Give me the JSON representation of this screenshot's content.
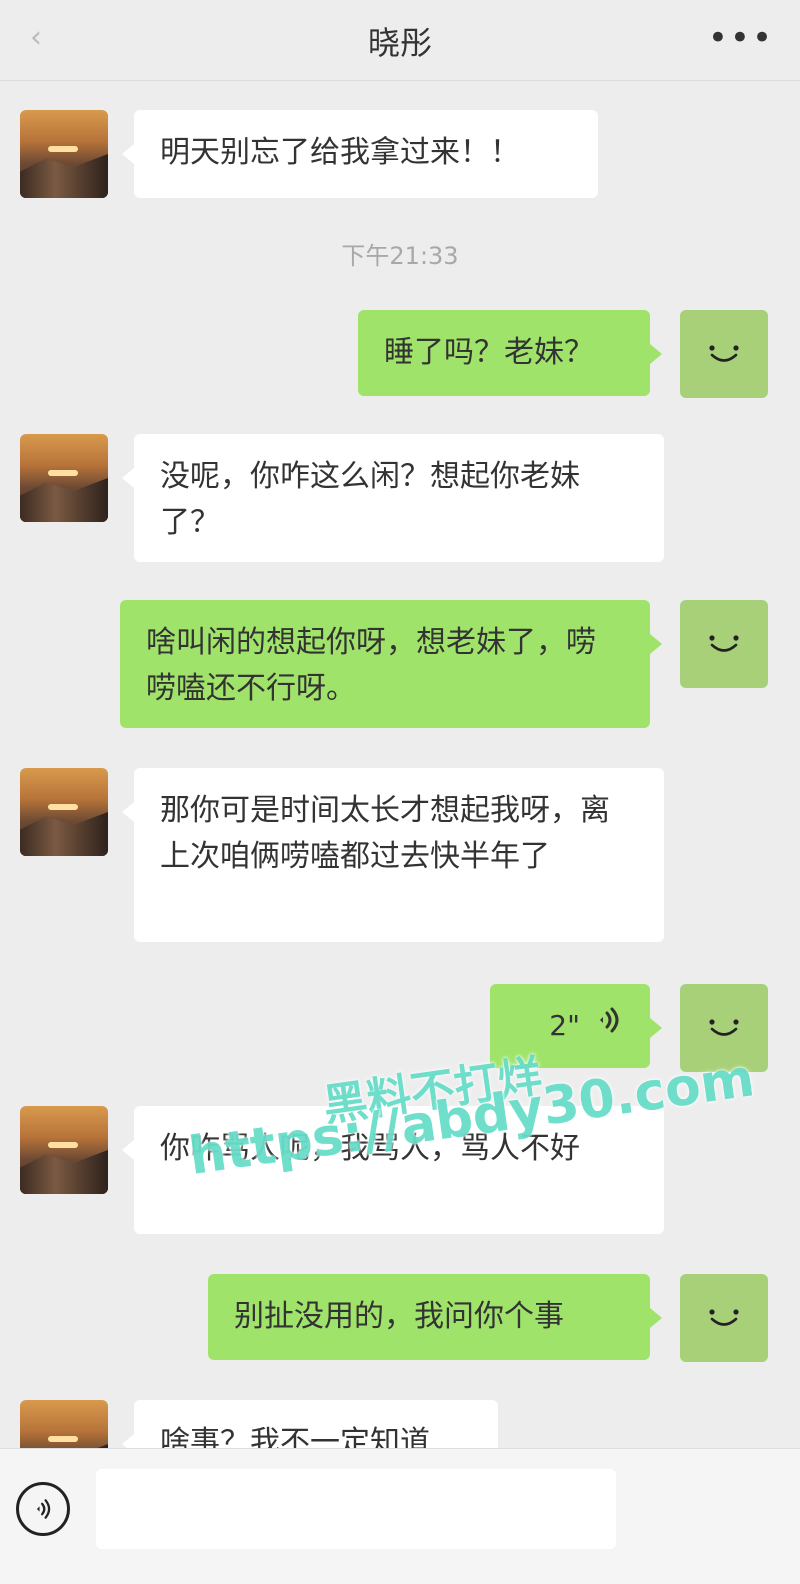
{
  "header": {
    "title": "晓彤",
    "more_label": "•••"
  },
  "timestamp": "下午21:33",
  "messages": [
    {
      "side": "left",
      "text": "明天别忘了给我拿过来！！"
    },
    {
      "side": "right",
      "text": "睡了吗？老妹？"
    },
    {
      "side": "left",
      "text": "没呢，你咋这么闲？想起你老妹了？"
    },
    {
      "side": "right",
      "text": "啥叫闲的想起你呀，想老妹了，唠唠嗑还不行呀。"
    },
    {
      "side": "left",
      "text": "那你可是时间太长才想起我呀，离上次咱俩唠嗑都过去快半年了"
    },
    {
      "side": "right",
      "voice_seconds": "2\""
    },
    {
      "side": "left",
      "text": "你咋骂人呢，我骂人，骂人不好"
    },
    {
      "side": "right",
      "text": "别扯没用的，我问你个事"
    },
    {
      "side": "left",
      "text": "啥事？我不一定知道"
    }
  ],
  "watermark": {
    "line1": "黑料不打烊",
    "line2": "https://abdy30.com"
  },
  "icons": {
    "back": "back-arrow-icon",
    "more": "more-dots-icon",
    "self_avatar": "smiley-icon",
    "voice_mode": "voice-icon",
    "voice_wave": "voice-wave-icon"
  },
  "colors": {
    "background": "#ededed",
    "self_bubble": "#a0e36a",
    "other_bubble": "#ffffff",
    "watermark": "#68ddc8"
  }
}
